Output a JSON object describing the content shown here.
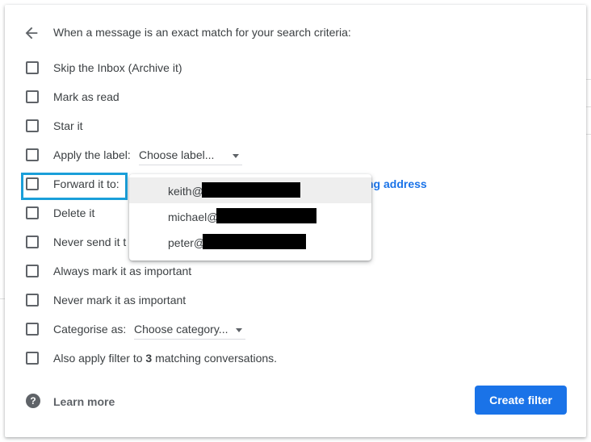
{
  "header": {
    "text": "When a message is an exact match for your search criteria:"
  },
  "options": {
    "skip_inbox": "Skip the Inbox (Archive it)",
    "mark_read": "Mark as read",
    "star": "Star it",
    "apply_label": "Apply the label:",
    "label_select": "Choose label...",
    "forward": "Forward it to:",
    "add_forward": "ng address",
    "delete": "Delete it",
    "never_spam": "Never send it t",
    "always_important": "Always mark it as important",
    "never_important": "Never mark it as important",
    "categorise": "Categorise as:",
    "category_select": "Choose category...",
    "also_apply_prefix": "Also apply filter to ",
    "also_apply_count": "3",
    "also_apply_suffix": " matching conversations."
  },
  "forward_dropdown": {
    "items": [
      {
        "name": "keith@"
      },
      {
        "name": "michael@"
      },
      {
        "name": "peter@"
      }
    ]
  },
  "footer": {
    "learn_more": "Learn more",
    "create_filter": "Create filter"
  },
  "icons": {
    "back": "arrow-left-icon",
    "help": "help-circle-icon",
    "caret": "caret-down-icon"
  },
  "colors": {
    "accent": "#1a73e8",
    "highlight": "#1a9fd9",
    "text": "#3c4043",
    "redaction": "#000000"
  }
}
